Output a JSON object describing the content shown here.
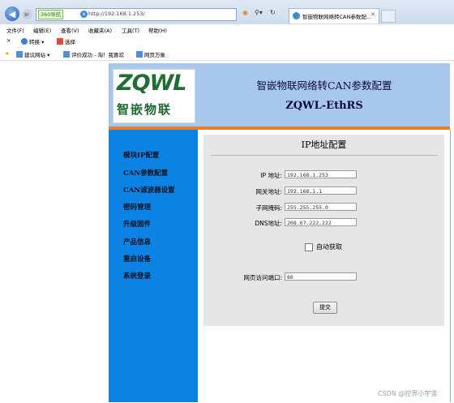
{
  "browser": {
    "tag360": "360导航",
    "url": "http://192.168.1.253/",
    "tab_title": "智嵌物联网络转CAN参数配...",
    "menu": [
      "文件(F)",
      "编辑(E)",
      "查看(V)",
      "收藏夹(A)",
      "工具(T)",
      "帮助(H)"
    ],
    "cmd": {
      "convert": "转换",
      "select": "选择"
    },
    "favorites": [
      "建议网站 ▾",
      "评价成功 - 淘！我喜欢",
      "网页万象"
    ]
  },
  "banner": {
    "logo_text": "ZQWL",
    "logo_sub": "智嵌物联",
    "title": "智嵌物联网络转CAN参数配置",
    "model": "ZQWL-EthRS"
  },
  "sidebar": {
    "items": [
      "模块IP配置",
      "CAN参数配置",
      "CAN滤波器设置",
      "密码管理",
      "升级固件",
      "产品信息",
      "重启设备",
      "系统登录"
    ]
  },
  "form": {
    "title": "IP地址配置",
    "fields": [
      {
        "label": "IP 地址:",
        "value": "192.168.1.253"
      },
      {
        "label": "网关地址:",
        "value": "192.168.1.1"
      },
      {
        "label": "子网掩码:",
        "value": "255.255.255.0"
      },
      {
        "label": "DNS地址:",
        "value": "208.67.222.222"
      }
    ],
    "auto_label": "自动获取",
    "port_label": "网页访问端口:",
    "port_value": "80",
    "submit": "提交"
  },
  "watermark": "CSDN @控界小宇宙"
}
